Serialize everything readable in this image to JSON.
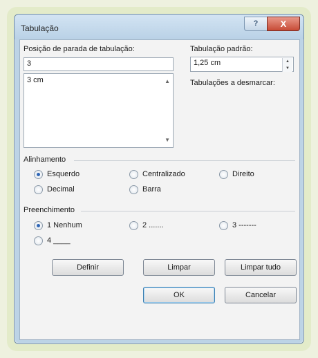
{
  "window": {
    "title": "Tabulação",
    "help_button": "?",
    "close_button": "X"
  },
  "tab_stop_position": {
    "label": "Posição de parada de tabulação:",
    "value": "3",
    "list_items": [
      "3 cm"
    ]
  },
  "default_tab_stops": {
    "label": "Tabulação padrão:",
    "value": "1,25 cm"
  },
  "tabs_to_clear": {
    "label": "Tabulações a desmarcar:"
  },
  "alignment": {
    "label": "Alinhamento",
    "options": [
      {
        "label": "Esquerdo",
        "selected": true
      },
      {
        "label": "Centralizado",
        "selected": false
      },
      {
        "label": "Direito",
        "selected": false
      },
      {
        "label": "Decimal",
        "selected": false
      },
      {
        "label": "Barra",
        "selected": false
      }
    ]
  },
  "leader": {
    "label": "Preenchimento",
    "options": [
      {
        "label": "1 Nenhum",
        "selected": true
      },
      {
        "label": "2 .......",
        "selected": false
      },
      {
        "label": "3 -------",
        "selected": false
      },
      {
        "label": "4 ____",
        "selected": false
      }
    ]
  },
  "buttons": {
    "set": "Definir",
    "clear": "Limpar",
    "clear_all": "Limpar tudo",
    "ok": "OK",
    "cancel": "Cancelar"
  },
  "colors": {
    "selected_radio": "#2f66b6",
    "close_button": "#c74b36"
  }
}
